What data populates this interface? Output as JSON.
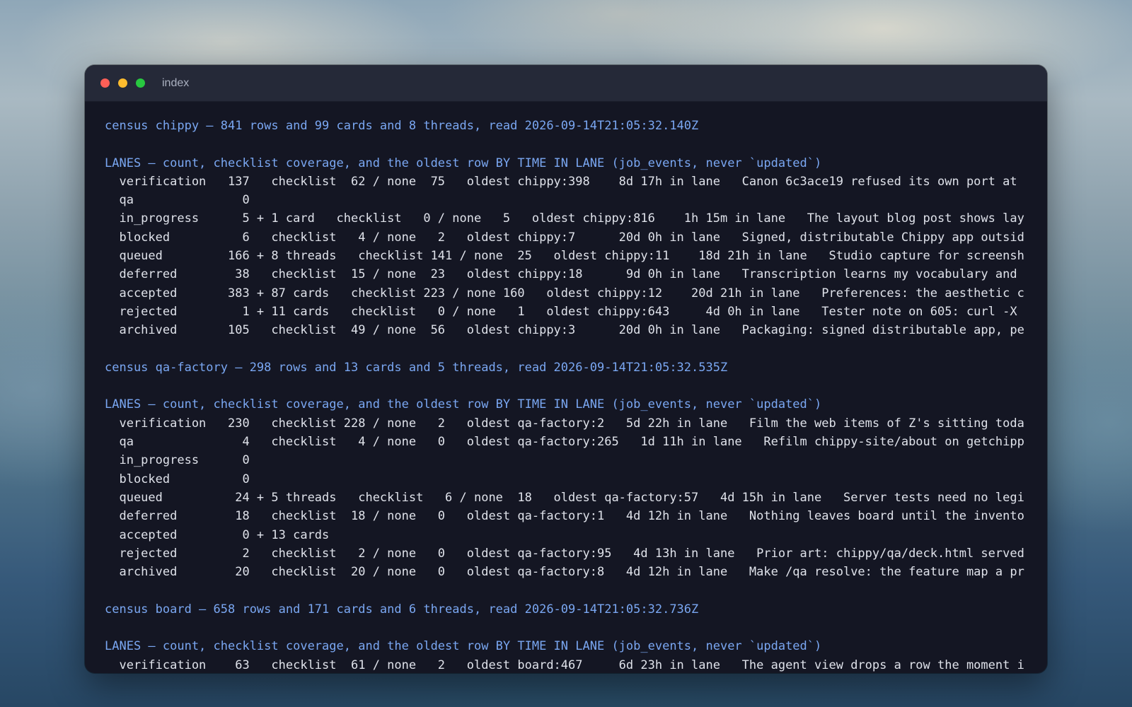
{
  "window": {
    "title": "index",
    "colors": {
      "header_text": "#7aa7f2",
      "body_text": "#dfe2ea",
      "background": "#141623",
      "titlebar": "#252938",
      "close": "#fe5f57",
      "minimize": "#febc2e",
      "zoom": "#28c840"
    }
  },
  "terminal": {
    "census_chippy": {
      "summary": "census chippy — 841 rows and 99 cards and 8 threads, read 2026-09-14T21:05:32.140Z",
      "lanes_header": "LANES — count, checklist coverage, and the oldest row BY TIME IN LANE (job_events, never `updated`)",
      "rows": [
        "  verification   137   checklist  62 / none  75   oldest chippy:398    8d 17h in lane   Canon 6c3ace19 refused its own port at",
        "  qa               0",
        "  in_progress      5 + 1 card   checklist   0 / none   5   oldest chippy:816    1h 15m in lane   The layout blog post shows lay",
        "  blocked          6   checklist   4 / none   2   oldest chippy:7      20d 0h in lane   Signed, distributable Chippy app outsid",
        "  queued         166 + 8 threads   checklist 141 / none  25   oldest chippy:11    18d 21h in lane   Studio capture for screensh",
        "  deferred        38   checklist  15 / none  23   oldest chippy:18      9d 0h in lane   Transcription learns my vocabulary and",
        "  accepted       383 + 87 cards   checklist 223 / none 160   oldest chippy:12    20d 21h in lane   Preferences: the aesthetic c",
        "  rejected         1 + 11 cards   checklist   0 / none   1   oldest chippy:643     4d 0h in lane   Tester note on 605: curl -X",
        "  archived       105   checklist  49 / none  56   oldest chippy:3      20d 0h in lane   Packaging: signed distributable app, pe"
      ]
    },
    "census_qa_factory": {
      "summary": "census qa-factory — 298 rows and 13 cards and 5 threads, read 2026-09-14T21:05:32.535Z",
      "lanes_header": "LANES — count, checklist coverage, and the oldest row BY TIME IN LANE (job_events, never `updated`)",
      "rows": [
        "  verification   230   checklist 228 / none   2   oldest qa-factory:2   5d 22h in lane   Film the web items of Z's sitting toda",
        "  qa               4   checklist   4 / none   0   oldest qa-factory:265   1d 11h in lane   Refilm chippy-site/about on getchipp",
        "  in_progress      0",
        "  blocked          0",
        "  queued          24 + 5 threads   checklist   6 / none  18   oldest qa-factory:57   4d 15h in lane   Server tests need no legi",
        "  deferred        18   checklist  18 / none   0   oldest qa-factory:1   4d 12h in lane   Nothing leaves board until the invento",
        "  accepted         0 + 13 cards",
        "  rejected         2   checklist   2 / none   0   oldest qa-factory:95   4d 13h in lane   Prior art: chippy/qa/deck.html served",
        "  archived        20   checklist  20 / none   0   oldest qa-factory:8   4d 12h in lane   Make /qa resolve: the feature map a pr"
      ]
    },
    "census_board": {
      "summary": "census board — 658 rows and 171 cards and 6 threads, read 2026-09-14T21:05:32.736Z",
      "lanes_header": "LANES — count, checklist coverage, and the oldest row BY TIME IN LANE (job_events, never `updated`)",
      "rows": [
        "  verification    63   checklist  61 / none   2   oldest board:467     6d 23h in lane   The agent view drops a row the moment i"
      ]
    }
  }
}
